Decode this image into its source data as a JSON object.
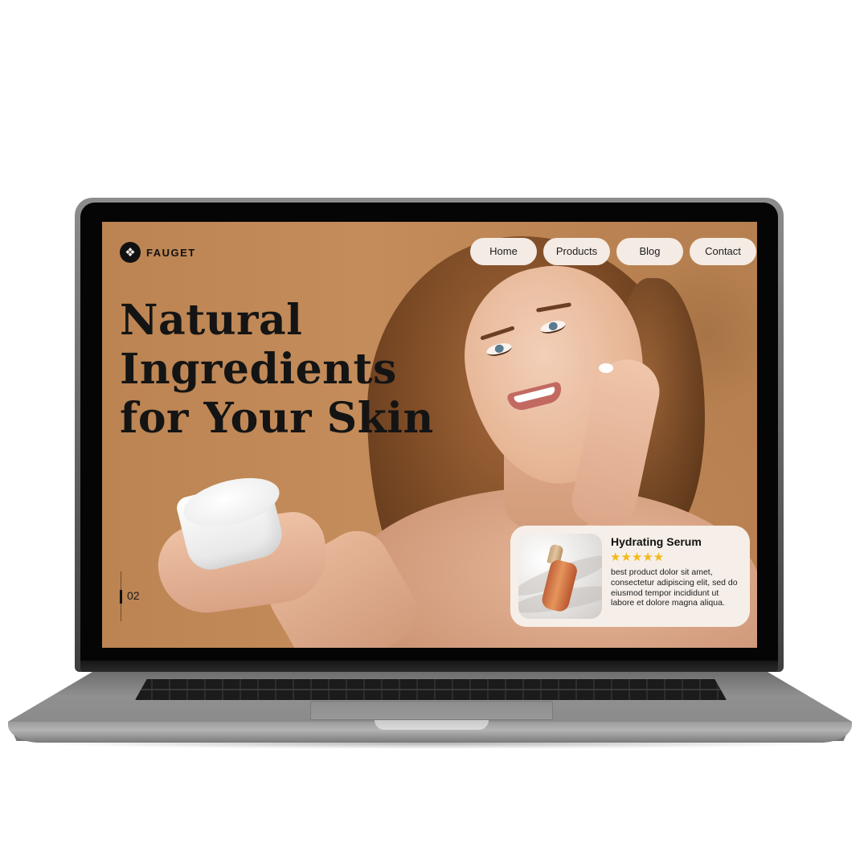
{
  "brand": {
    "name": "FAUGET",
    "logo_icon": "flower-ornament-icon"
  },
  "nav": {
    "items": [
      {
        "label": "Home"
      },
      {
        "label": "Products"
      },
      {
        "label": "Blog"
      },
      {
        "label": "Contact"
      }
    ]
  },
  "hero": {
    "headline_lines": [
      "Natural",
      "Ingredients",
      "for Your Skin"
    ]
  },
  "slider": {
    "current": "02"
  },
  "product_card": {
    "title": "Hydrating Serum",
    "stars": "★★★★★",
    "rating": 5,
    "description": "best product dolor sit amet, consectetur adipiscing elit, sed do eiusmod tempor incididunt ut labore et dolore magna aliqua."
  },
  "colors": {
    "background": "#c08755",
    "nav_pill": "#f4ebe4",
    "card": "#f6efe9",
    "star": "#f2b91b",
    "text": "#141414"
  }
}
